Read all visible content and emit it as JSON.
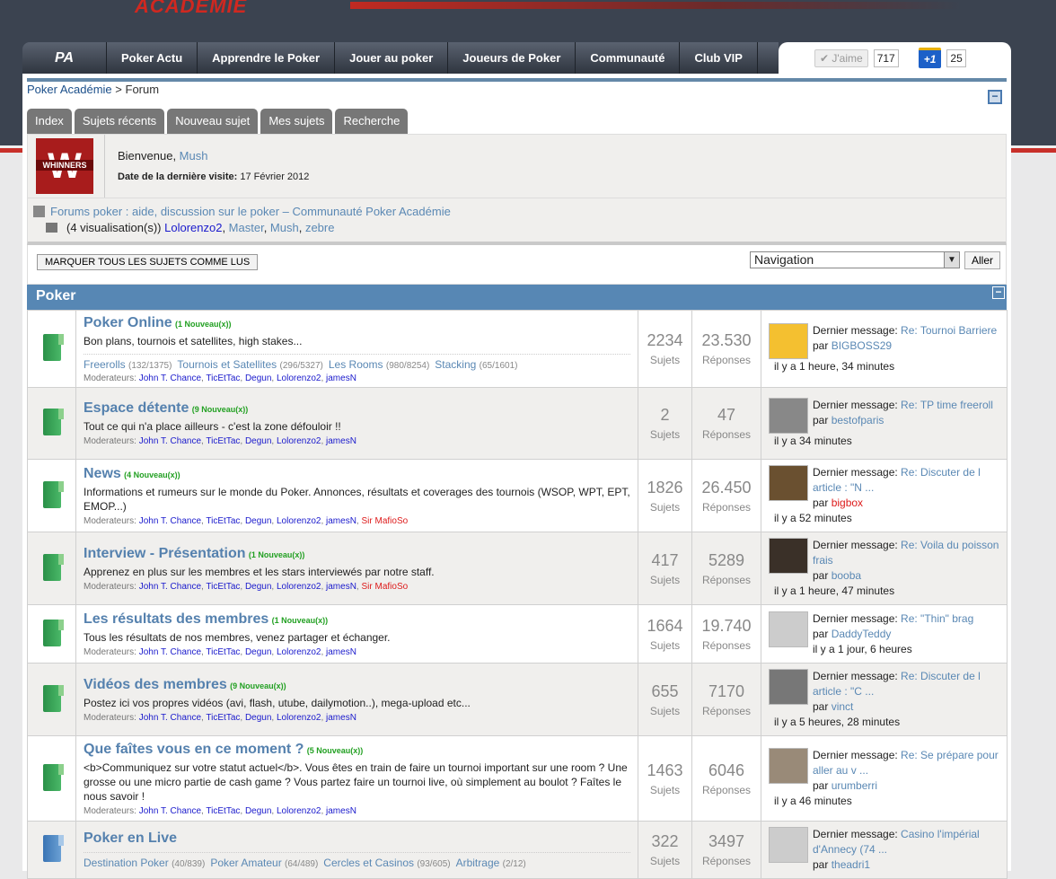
{
  "header": {
    "banner_logo": "ACADEMIE"
  },
  "nav": {
    "home": "PA",
    "items": [
      "Poker Actu",
      "Apprendre le Poker",
      "Jouer au poker",
      "Joueurs de Poker",
      "Communauté",
      "Club VIP"
    ]
  },
  "social": {
    "like_label": "✔ J'aime",
    "like_count": "717",
    "plus_label": "+1",
    "plus_count": "25"
  },
  "breadcrumb": {
    "root": "Poker Académie",
    "sep": " > ",
    "current": "Forum"
  },
  "tabs": [
    "Index",
    "Sujets récents",
    "Nouveau sujet",
    "Mes sujets",
    "Recherche"
  ],
  "welcome": {
    "greeting": "Bienvenue, ",
    "user": "Mush",
    "last_visit_label": "Date de la dernière visite:",
    "last_visit": " 17 Février 2012",
    "avatar_text": "WHINNERS"
  },
  "viewers": {
    "forum_title": "Forums poker : aide, discussion sur le poker – Communauté Poker Académie",
    "count": "(4 visualisation(s))",
    "users": [
      {
        "name": "Lolorenzo2",
        "color": "blue"
      },
      {
        "name": "Master",
        "color": "link"
      },
      {
        "name": "Mush",
        "color": "link"
      },
      {
        "name": "zebre",
        "color": "link"
      }
    ]
  },
  "actions": {
    "mark_all": "Marquer tous les sujets comme lus",
    "nav_select": "Navigation",
    "go": "Aller"
  },
  "category": {
    "title": "Poker",
    "collapse": "−"
  },
  "labels": {
    "sujets": "Sujets",
    "reponses": "Réponses",
    "last_msg": "Dernier message: ",
    "by": "par ",
    "mods": "Moderateurs: "
  },
  "forums": [
    {
      "title": "Poker Online",
      "new": "(1 Nouveau(x))",
      "desc": "Bon plans, tournois et satellites, high stakes...",
      "subs": [
        [
          "Freerolls",
          "(132/1375)"
        ],
        [
          "Tournois et Satellites",
          "(296/5327)"
        ],
        [
          "Les Rooms",
          "(980/8254)"
        ],
        [
          "Stacking",
          "(65/1601)"
        ]
      ],
      "mods": [
        "John T. Chance",
        "TicEtTac",
        "Degun",
        "Lolorenzo2",
        "jamesN"
      ],
      "red_mods": [],
      "sujets": "2234",
      "reponses": "23.530",
      "last_title": "Re: Tournoi Barriere",
      "last_by": "BIGBOSS29",
      "by_red": false,
      "last_time": "il y a 1 heure, 34 minutes",
      "icon": "green",
      "thumb": "#f4c030"
    },
    {
      "title": "Espace détente",
      "new": "(9 Nouveau(x))",
      "desc": "Tout ce qui n'a place ailleurs - c'est la zone défouloir !!",
      "subs": [],
      "mods": [
        "John T. Chance",
        "TicEtTac",
        "Degun",
        "Lolorenzo2",
        "jamesN"
      ],
      "red_mods": [],
      "sujets": "2",
      "reponses": "47",
      "last_title": "Re: TP time freeroll",
      "last_by": "bestofparis",
      "by_red": false,
      "last_time": "il y a 34 minutes",
      "icon": "green",
      "thumb": "#888"
    },
    {
      "title": "News",
      "new": "(4 Nouveau(x))",
      "desc": "Informations et rumeurs sur le monde du Poker. Annonces, résultats et coverages des tournois (WSOP, WPT, EPT, EMOP...)",
      "subs": [],
      "mods": [
        "John T. Chance",
        "TicEtTac",
        "Degun",
        "Lolorenzo2",
        "jamesN"
      ],
      "red_mods": [
        "Sir MafioSo"
      ],
      "sujets": "1826",
      "reponses": "26.450",
      "last_title": "Re: Discuter de l article : \"N ...",
      "last_by": "bigbox",
      "by_red": true,
      "last_time": "il y a 52 minutes",
      "icon": "green",
      "thumb": "#6a5030"
    },
    {
      "title": "Interview - Présentation",
      "new": "(1 Nouveau(x))",
      "desc": "Apprenez en plus sur les membres et les stars interviewés par notre staff.",
      "subs": [],
      "mods": [
        "John T. Chance",
        "TicEtTac",
        "Degun",
        "Lolorenzo2",
        "jamesN"
      ],
      "red_mods": [
        "Sir MafioSo"
      ],
      "sujets": "417",
      "reponses": "5289",
      "last_title": "Re: Voila du poisson frais",
      "last_by": "booba",
      "by_red": false,
      "last_time": "il y a 1 heure, 47 minutes",
      "icon": "green",
      "thumb": "#3a3028"
    },
    {
      "title": "Les résultats des membres",
      "new": "(1 Nouveau(x))",
      "desc": "Tous les résultats de nos membres, venez partager et échanger.",
      "subs": [],
      "mods": [
        "John T. Chance",
        "TicEtTac",
        "Degun",
        "Lolorenzo2",
        "jamesN"
      ],
      "red_mods": [],
      "sujets": "1664",
      "reponses": "19.740",
      "last_title": "Re: \"Thin\" brag",
      "last_by": "DaddyTeddy",
      "by_red": false,
      "last_time": "il y a 1 jour, 6 heures",
      "icon": "green",
      "thumb": "#ccc",
      "inline_time": true
    },
    {
      "title": "Vidéos des membres",
      "new": "(9 Nouveau(x))",
      "desc": "Postez ici vos propres vidéos (avi, flash, utube, dailymotion..), mega-upload etc...",
      "subs": [],
      "mods": [
        "John T. Chance",
        "TicEtTac",
        "Degun",
        "Lolorenzo2",
        "jamesN"
      ],
      "red_mods": [],
      "sujets": "655",
      "reponses": "7170",
      "last_title": "Re: Discuter de l article : \"C ...",
      "last_by": "vinct",
      "by_red": false,
      "last_time": "il y a 5 heures, 28 minutes",
      "icon": "green",
      "thumb": "#777"
    },
    {
      "title": "Que faîtes vous en ce moment ?",
      "new": "(5 Nouveau(x))",
      "desc": "<b>Communiquez sur votre statut actuel</b>. Vous êtes en train de faire un tournoi important sur une room ? Une grosse ou une micro partie de cash game ? Vous partez faire un tournoi live, où simplement au boulot ? Faîtes le nous savoir !",
      "subs": [],
      "mods": [
        "John T. Chance",
        "TicEtTac",
        "Degun",
        "Lolorenzo2",
        "jamesN"
      ],
      "red_mods": [],
      "sujets": "1463",
      "reponses": "6046",
      "last_title": "Re: Se prépare pour aller au v ...",
      "last_by": "urumberri",
      "by_red": false,
      "last_time": "il y a 46 minutes",
      "icon": "green",
      "thumb": "#998a78"
    },
    {
      "title": "Poker en Live",
      "new": "",
      "desc": "",
      "subs": [
        [
          "Destination Poker",
          "(40/839)"
        ],
        [
          "Poker Amateur",
          "(64/489)"
        ],
        [
          "Cercles et Casinos",
          "(93/605)"
        ],
        [
          "Arbitrage",
          "(2/12)"
        ]
      ],
      "mods": [],
      "red_mods": [],
      "sujets": "322",
      "reponses": "3497",
      "last_title": "Casino l'impérial d'Annecy (74 ...",
      "last_by": "theadri1",
      "by_red": false,
      "last_time": "",
      "icon": "blue",
      "thumb": "#ccc"
    }
  ]
}
